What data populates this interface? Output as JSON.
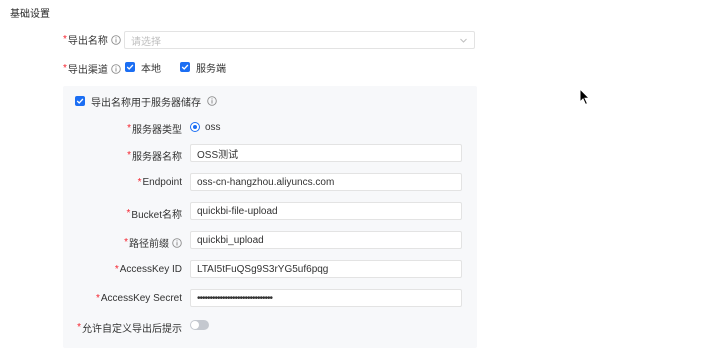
{
  "section": {
    "title": "基础设置"
  },
  "export_name": {
    "label": "导出名称",
    "placeholder": "请选择"
  },
  "export_channel": {
    "label": "导出渠道",
    "options": [
      {
        "label": "本地",
        "checked": true
      },
      {
        "label": "服务端",
        "checked": true
      }
    ]
  },
  "server_panel": {
    "checkbox_label": "导出名称用于服务器储存",
    "checked": true,
    "server_type": {
      "label": "服务器类型",
      "value": "oss"
    },
    "server_name": {
      "label": "服务器名称",
      "value": "OSS测试"
    },
    "endpoint": {
      "label": "Endpoint",
      "value": "oss-cn-hangzhou.aliyuncs.com"
    },
    "bucket": {
      "label": "Bucket名称",
      "value": "quickbi-file-upload"
    },
    "path_prefix": {
      "label": "路径前缀",
      "value": "quickbi_upload"
    },
    "access_key_id": {
      "label": "AccessKey ID",
      "value": "LTAI5tFuQSg9S3rYG5uf6pqg"
    },
    "access_key_secret": {
      "label": "AccessKey Secret",
      "value": "••••••••••••••••••••••••••••••"
    },
    "allow_custom_hint": {
      "label": "允许自定义导出后提示",
      "enabled": false
    }
  },
  "colors": {
    "accent": "#1b6ef3",
    "required": "#f5222d",
    "panel_bg": "#f7f8fa"
  },
  "icons": {
    "info": "info-icon",
    "dropdown": "chevron-down-icon",
    "check": "check-icon"
  }
}
